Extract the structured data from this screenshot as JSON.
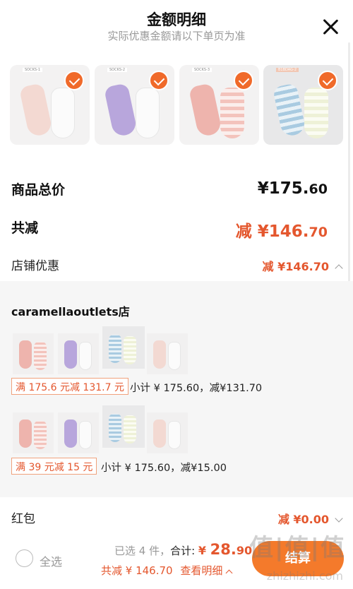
{
  "header": {
    "title": "金额明细",
    "subtitle": "实际优惠金额请以下单页为准"
  },
  "products": [
    {
      "name": "product-1",
      "selected": true,
      "tag": "SOCKS-1"
    },
    {
      "name": "product-2",
      "selected": true,
      "tag": "SOCKS-2"
    },
    {
      "name": "product-3",
      "selected": true,
      "tag": "SOCKS-3"
    },
    {
      "name": "product-4",
      "selected": true,
      "tag": "B1BDAG-2"
    }
  ],
  "summary": {
    "total_label": "商品总价",
    "total_price_int": "¥175.",
    "total_price_dec": "60",
    "reduce_label": "共减",
    "reduce_price_int": "减 ¥146.",
    "reduce_price_dec": "70",
    "shop_discount_label": "店铺优惠",
    "shop_discount_value": "减 ¥146.70"
  },
  "store": {
    "name": "caramellaoutlets店",
    "groups": [
      {
        "promo": "满 175.6 元减 131.7 元",
        "subtotal": "小计 ¥ 175.60，减¥131.70"
      },
      {
        "promo": "满 39 元减 15 元",
        "subtotal": "小计 ¥ 175.60，减¥15.00"
      }
    ]
  },
  "redpacket": {
    "label": "红包",
    "value": "减 ¥0.00"
  },
  "footer": {
    "select_all": "全选",
    "selected_count": "已选 4 件，",
    "total_label": "合计: ",
    "total_symbol": "¥ ",
    "total_int": "28.",
    "total_dec": "90",
    "reduce_text": "共减 ¥ 146.70",
    "detail_link": "查看明细",
    "settle_button": "结算"
  },
  "watermark": {
    "main": "值|值|值",
    "url": "zhizhizhi.com"
  },
  "colors": {
    "accent": "#e4572e",
    "check": "#f06a2a",
    "panel_bg": "#f6f6f6"
  }
}
